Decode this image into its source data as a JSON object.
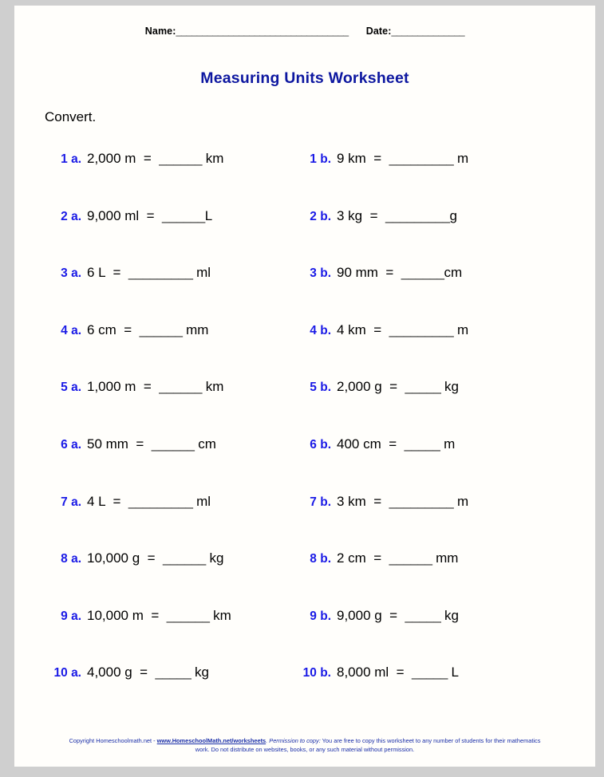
{
  "header": {
    "name_label": "Name:",
    "name_blank": "_________________________________",
    "date_label": "Date:",
    "date_blank": "______________"
  },
  "title": "Measuring Units Worksheet",
  "instruction": "Convert.",
  "problems": [
    {
      "a": {
        "number": "1 a.",
        "question": "2,000 m  =  ",
        "blank": "______",
        "unit": " km"
      },
      "b": {
        "number": "1 b.",
        "question": "9 km  =  ",
        "blank": "_________",
        "unit": " m"
      }
    },
    {
      "a": {
        "number": "2 a.",
        "question": "9,000 ml  =  ",
        "blank": "______",
        "unit": "L"
      },
      "b": {
        "number": "2 b.",
        "question": "3 kg  =  ",
        "blank": "_________",
        "unit": "g"
      }
    },
    {
      "a": {
        "number": "3 a.",
        "question": "6 L  =  ",
        "blank": "_________",
        "unit": " ml"
      },
      "b": {
        "number": "3 b.",
        "question": "90 mm  =  ",
        "blank": "______",
        "unit": "cm"
      }
    },
    {
      "a": {
        "number": "4 a.",
        "question": "6 cm  =  ",
        "blank": "______",
        "unit": " mm"
      },
      "b": {
        "number": "4 b.",
        "question": "4 km  =  ",
        "blank": "_________",
        "unit": " m"
      }
    },
    {
      "a": {
        "number": "5 a.",
        "question": "1,000 m  =  ",
        "blank": "______",
        "unit": " km"
      },
      "b": {
        "number": "5 b.",
        "question": "2,000 g  =  ",
        "blank": "_____",
        "unit": " kg"
      }
    },
    {
      "a": {
        "number": "6 a.",
        "question": "50 mm  =  ",
        "blank": "______",
        "unit": " cm"
      },
      "b": {
        "number": "6 b.",
        "question": "400 cm  =  ",
        "blank": "_____",
        "unit": " m"
      }
    },
    {
      "a": {
        "number": "7 a.",
        "question": "4 L  =  ",
        "blank": "_________",
        "unit": " ml"
      },
      "b": {
        "number": "7 b.",
        "question": "3 km  =  ",
        "blank": "_________",
        "unit": " m"
      }
    },
    {
      "a": {
        "number": "8 a.",
        "question": "10,000 g  =  ",
        "blank": "______",
        "unit": " kg"
      },
      "b": {
        "number": "8 b.",
        "question": "2 cm  =  ",
        "blank": "______",
        "unit": " mm"
      }
    },
    {
      "a": {
        "number": "9 a.",
        "question": "10,000 m  =  ",
        "blank": "______",
        "unit": " km"
      },
      "b": {
        "number": "9 b.",
        "question": "9,000 g  =  ",
        "blank": "_____",
        "unit": " kg"
      }
    },
    {
      "a": {
        "number": "10 a.",
        "question": "4,000 g  =  ",
        "blank": "_____",
        "unit": " kg"
      },
      "b": {
        "number": "10 b.",
        "question": "8,000 ml  =  ",
        "blank": "_____",
        "unit": " L"
      }
    }
  ],
  "footer": {
    "copyright_prefix": "Copyright Homeschoolmath.net - ",
    "link": "www.HomeschoolMath.net/worksheets",
    "permission_label": ".  Permission to copy:",
    "permission_text": " You are free to copy this worksheet to any number of students for their mathematics work. Do not distribute on websites, books, or any such material without permission."
  },
  "colors": {
    "title": "#0d17a0",
    "problem_number": "#1a1ae6",
    "footer": "#1b2fa8",
    "page_background": "#fffefb",
    "frame": "#cfcfcf"
  }
}
